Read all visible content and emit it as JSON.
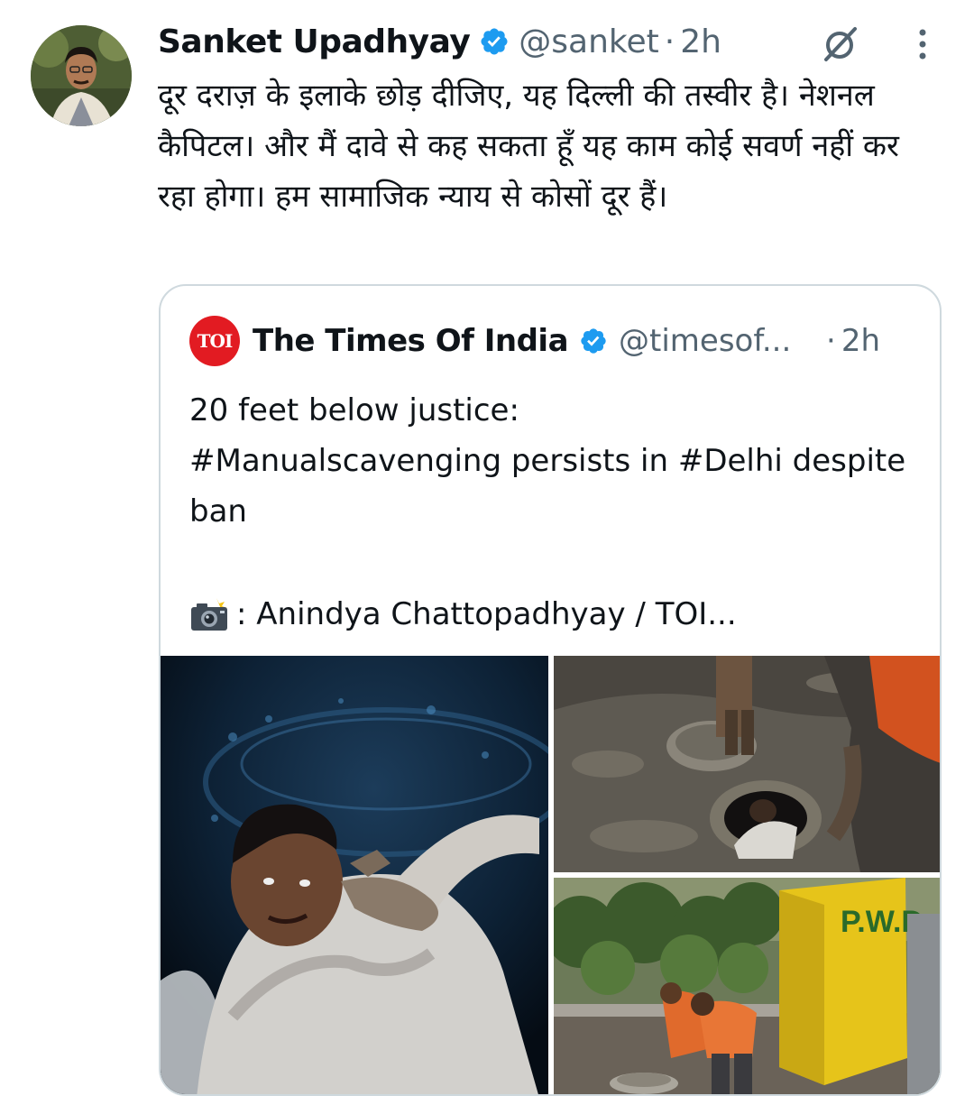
{
  "tweet": {
    "author_name": "Sanket Upadhyay",
    "handle": "@sanket",
    "separator": "·",
    "time": "2h",
    "text": "दूर दराज़ के इलाके छोड़ दीजिए, यह दिल्ली की तस्वीर है। नेशनल कैपिटल। और मैं दावे से कह सकता हूँ यह काम कोई सवर्ण नहीं कर रहा होगा। हम सामाजिक न्याय से कोसों दूर हैं।"
  },
  "quote": {
    "logo_text": "TOI",
    "author_name": "The Times Of India",
    "handle": "@timesof...",
    "separator": "·",
    "time": "2h",
    "text": "20 feet below justice:\n#Manualscavenging persists in #Delhi despite ban",
    "credit": ": Anindya Chattopadhyay / TOI..."
  },
  "icons": {
    "verified": "verified-badge-icon",
    "grok": "grok-icon",
    "more": "more-vertical-icon",
    "camera": "camera-flash-icon"
  },
  "colors": {
    "verified_blue": "#1d9bf0",
    "text_primary": "#0f1419",
    "text_secondary": "#536471",
    "border": "#cfd9de",
    "toi_red": "#e21b22"
  }
}
